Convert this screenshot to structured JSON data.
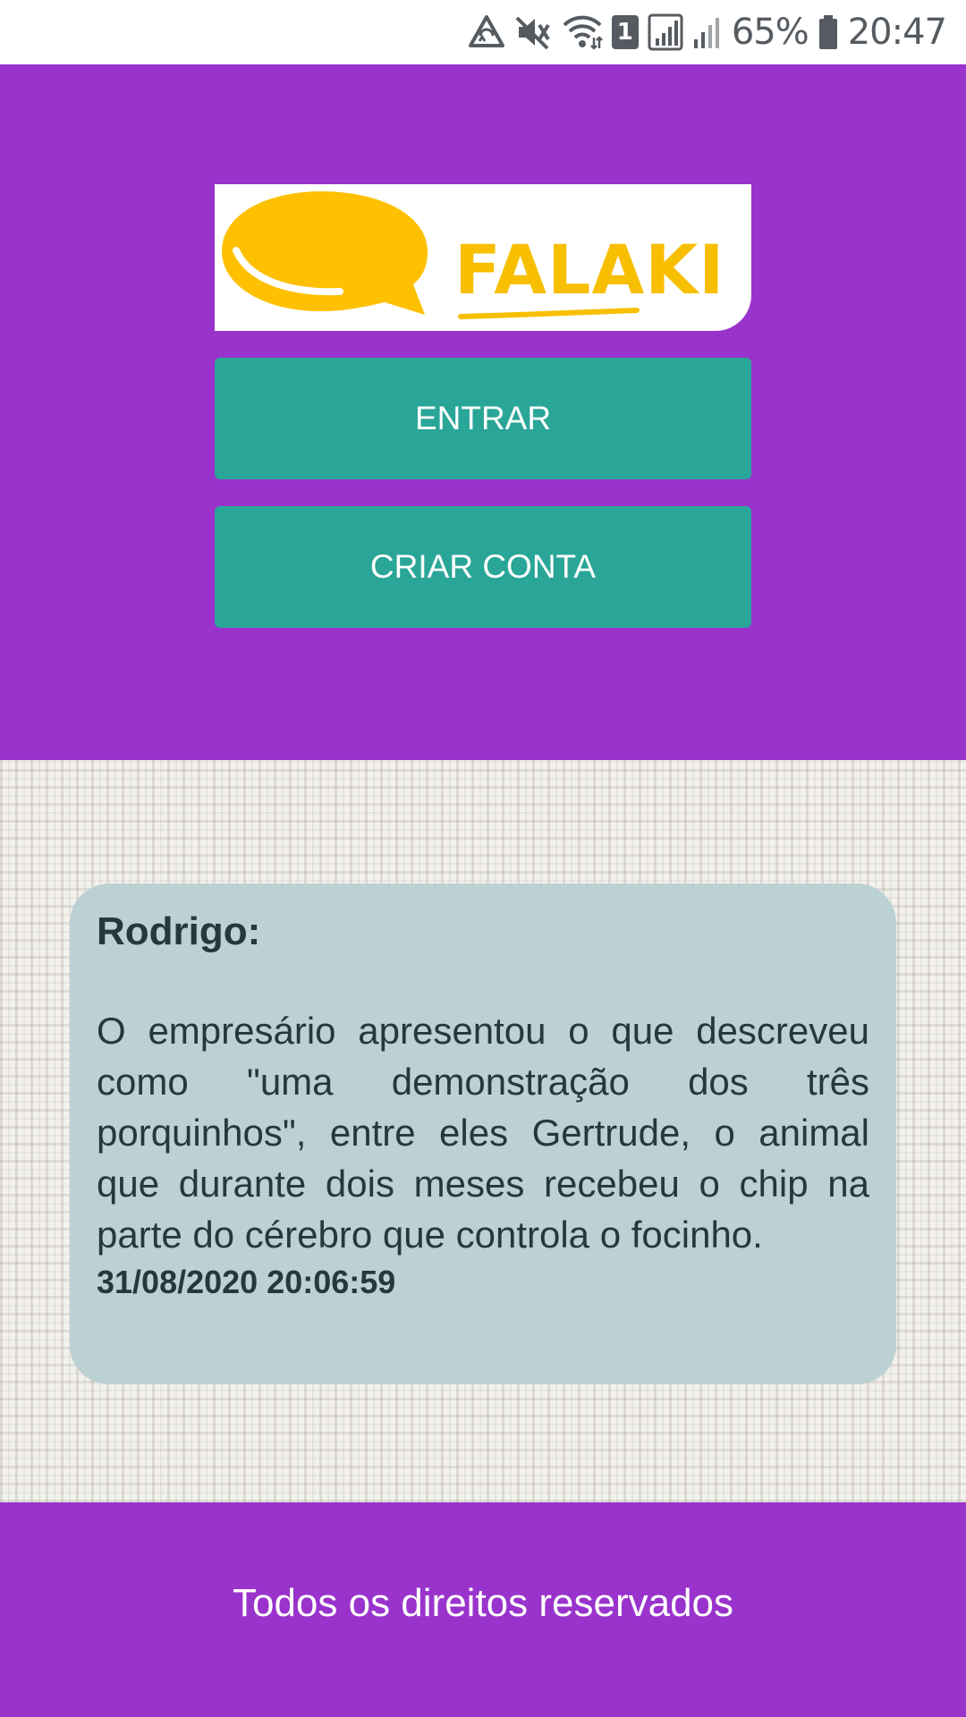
{
  "status_bar": {
    "battery_percent": "65%",
    "time": "20:47",
    "sim_slot": "1",
    "icons": [
      "data-saver-icon",
      "mute-icon",
      "wifi-icon",
      "sim-icon",
      "signal-icon",
      "signal-icon-2",
      "battery-icon"
    ]
  },
  "header": {
    "logo_text": "FALAKI",
    "entrar_label": "ENTRAR",
    "criar_conta_label": "CRIAR CONTA",
    "background_color": "#9933cc",
    "button_color": "#2aa698",
    "logo_color": "#f7bf00"
  },
  "message": {
    "author": "Rodrigo:",
    "text": "O empresário apresentou o que descreveu como \"uma demonstração dos três porquinhos\", entre eles Gertrude, o animal que durante dois meses recebeu o chip na parte do cérebro que controla o focinho.",
    "timestamp": "31/08/2020 20:06:59"
  },
  "footer": {
    "text": "Todos os direitos reservados"
  }
}
